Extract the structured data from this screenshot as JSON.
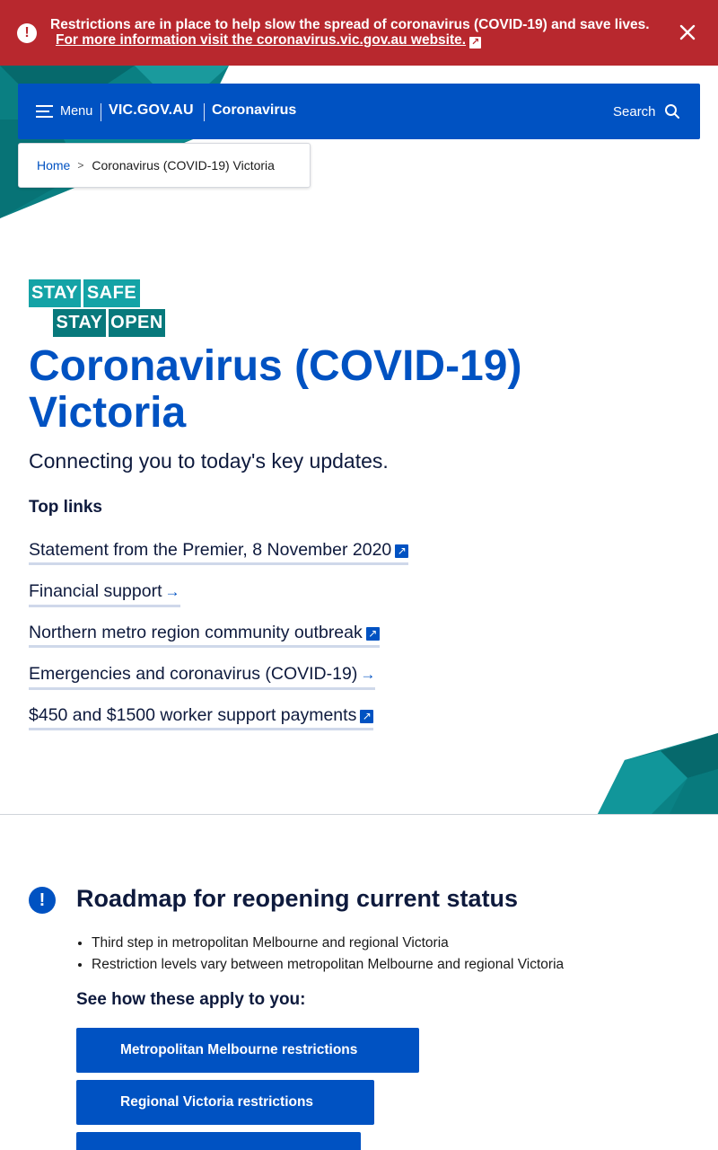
{
  "alert": {
    "text": "Restrictions are in place to help slow the spread of coronavirus (COVID-19) and save lives.",
    "link_text": "For more information visit the coronavirus.vic.gov.au website.",
    "icon": "exclamation-icon",
    "close_icon": "close-icon",
    "color": "#b8282e"
  },
  "header": {
    "menu_label": "Menu",
    "logo_text": "VIC.GOV.AU",
    "site_title": "Coronavirus",
    "search_label": "Search",
    "color": "#0052c2"
  },
  "breadcrumb": {
    "home": "Home",
    "separator": ">",
    "current": "Coronavirus (COVID-19) Victoria"
  },
  "stay_logo": {
    "stay1": "STAY",
    "safe": "SAFE",
    "stay2": "STAY",
    "open": "OPEN"
  },
  "main": {
    "title_line1": "Coronavirus (COVID-19)",
    "title_line2": "Victoria",
    "subtitle": "Connecting you to today's key updates.",
    "top_links_heading": "Top links",
    "top_links": [
      {
        "label": "Statement from the Premier, 8 November 2020",
        "icon": "external-link-icon"
      },
      {
        "label": "Financial support",
        "icon": "arrow-right-icon"
      },
      {
        "label": "Northern metro region community outbreak",
        "icon": "external-link-icon"
      },
      {
        "label": "Emergencies and coronavirus (COVID-19)",
        "icon": "arrow-right-icon"
      },
      {
        "label": "$450 and $1500 worker support payments",
        "icon": "external-link-icon"
      }
    ]
  },
  "roadmap": {
    "title": "Roadmap for reopening current status",
    "items": [
      "Third step in metropolitan Melbourne and regional Victoria",
      "Restriction levels vary between metropolitan Melbourne and regional Victoria"
    ],
    "apply_heading": "See how these apply to you:",
    "buttons": [
      "Metropolitan Melbourne restrictions",
      "Regional Victoria restrictions"
    ]
  }
}
